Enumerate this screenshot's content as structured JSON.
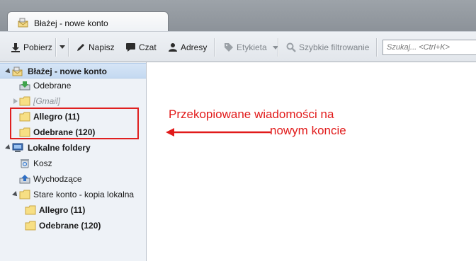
{
  "tab": {
    "title": "Błażej - nowe konto"
  },
  "toolbar": {
    "get_label": "Pobierz",
    "write_label": "Napisz",
    "chat_label": "Czat",
    "address_label": "Adresy",
    "tag_label": "Etykieta",
    "quickfilter_label": "Szybkie filtrowanie",
    "search_placeholder": "Szukaj... <Ctrl+K>"
  },
  "folders": [
    {
      "label": "Błażej - nowe konto",
      "icon": "account-icon",
      "selected": true
    },
    {
      "label": "Odebrane",
      "icon": "inbox-icon"
    },
    {
      "label": "[Gmail]",
      "icon": "folder-icon"
    },
    {
      "label": "Allegro (11)",
      "icon": "folder-icon"
    },
    {
      "label": "Odebrane (120)",
      "icon": "folder-icon"
    },
    {
      "label": "Lokalne foldery",
      "icon": "local-folders-icon"
    },
    {
      "label": "Kosz",
      "icon": "trash-icon"
    },
    {
      "label": "Wychodzące",
      "icon": "outbox-icon"
    },
    {
      "label": "Stare konto - kopia lokalna",
      "icon": "folder-icon"
    },
    {
      "label": "Allegro (11)",
      "icon": "folder-icon"
    },
    {
      "label": "Odebrane (120)",
      "icon": "folder-icon"
    }
  ],
  "annotation": {
    "line1": "Przekopiowane wiadomości na",
    "line2": "nowym koncie",
    "color": "#e11a1a"
  },
  "colors": {
    "selected_row": "#c4d9f1",
    "folder_pane": "#eef2f7",
    "highlight": "#e02020"
  }
}
